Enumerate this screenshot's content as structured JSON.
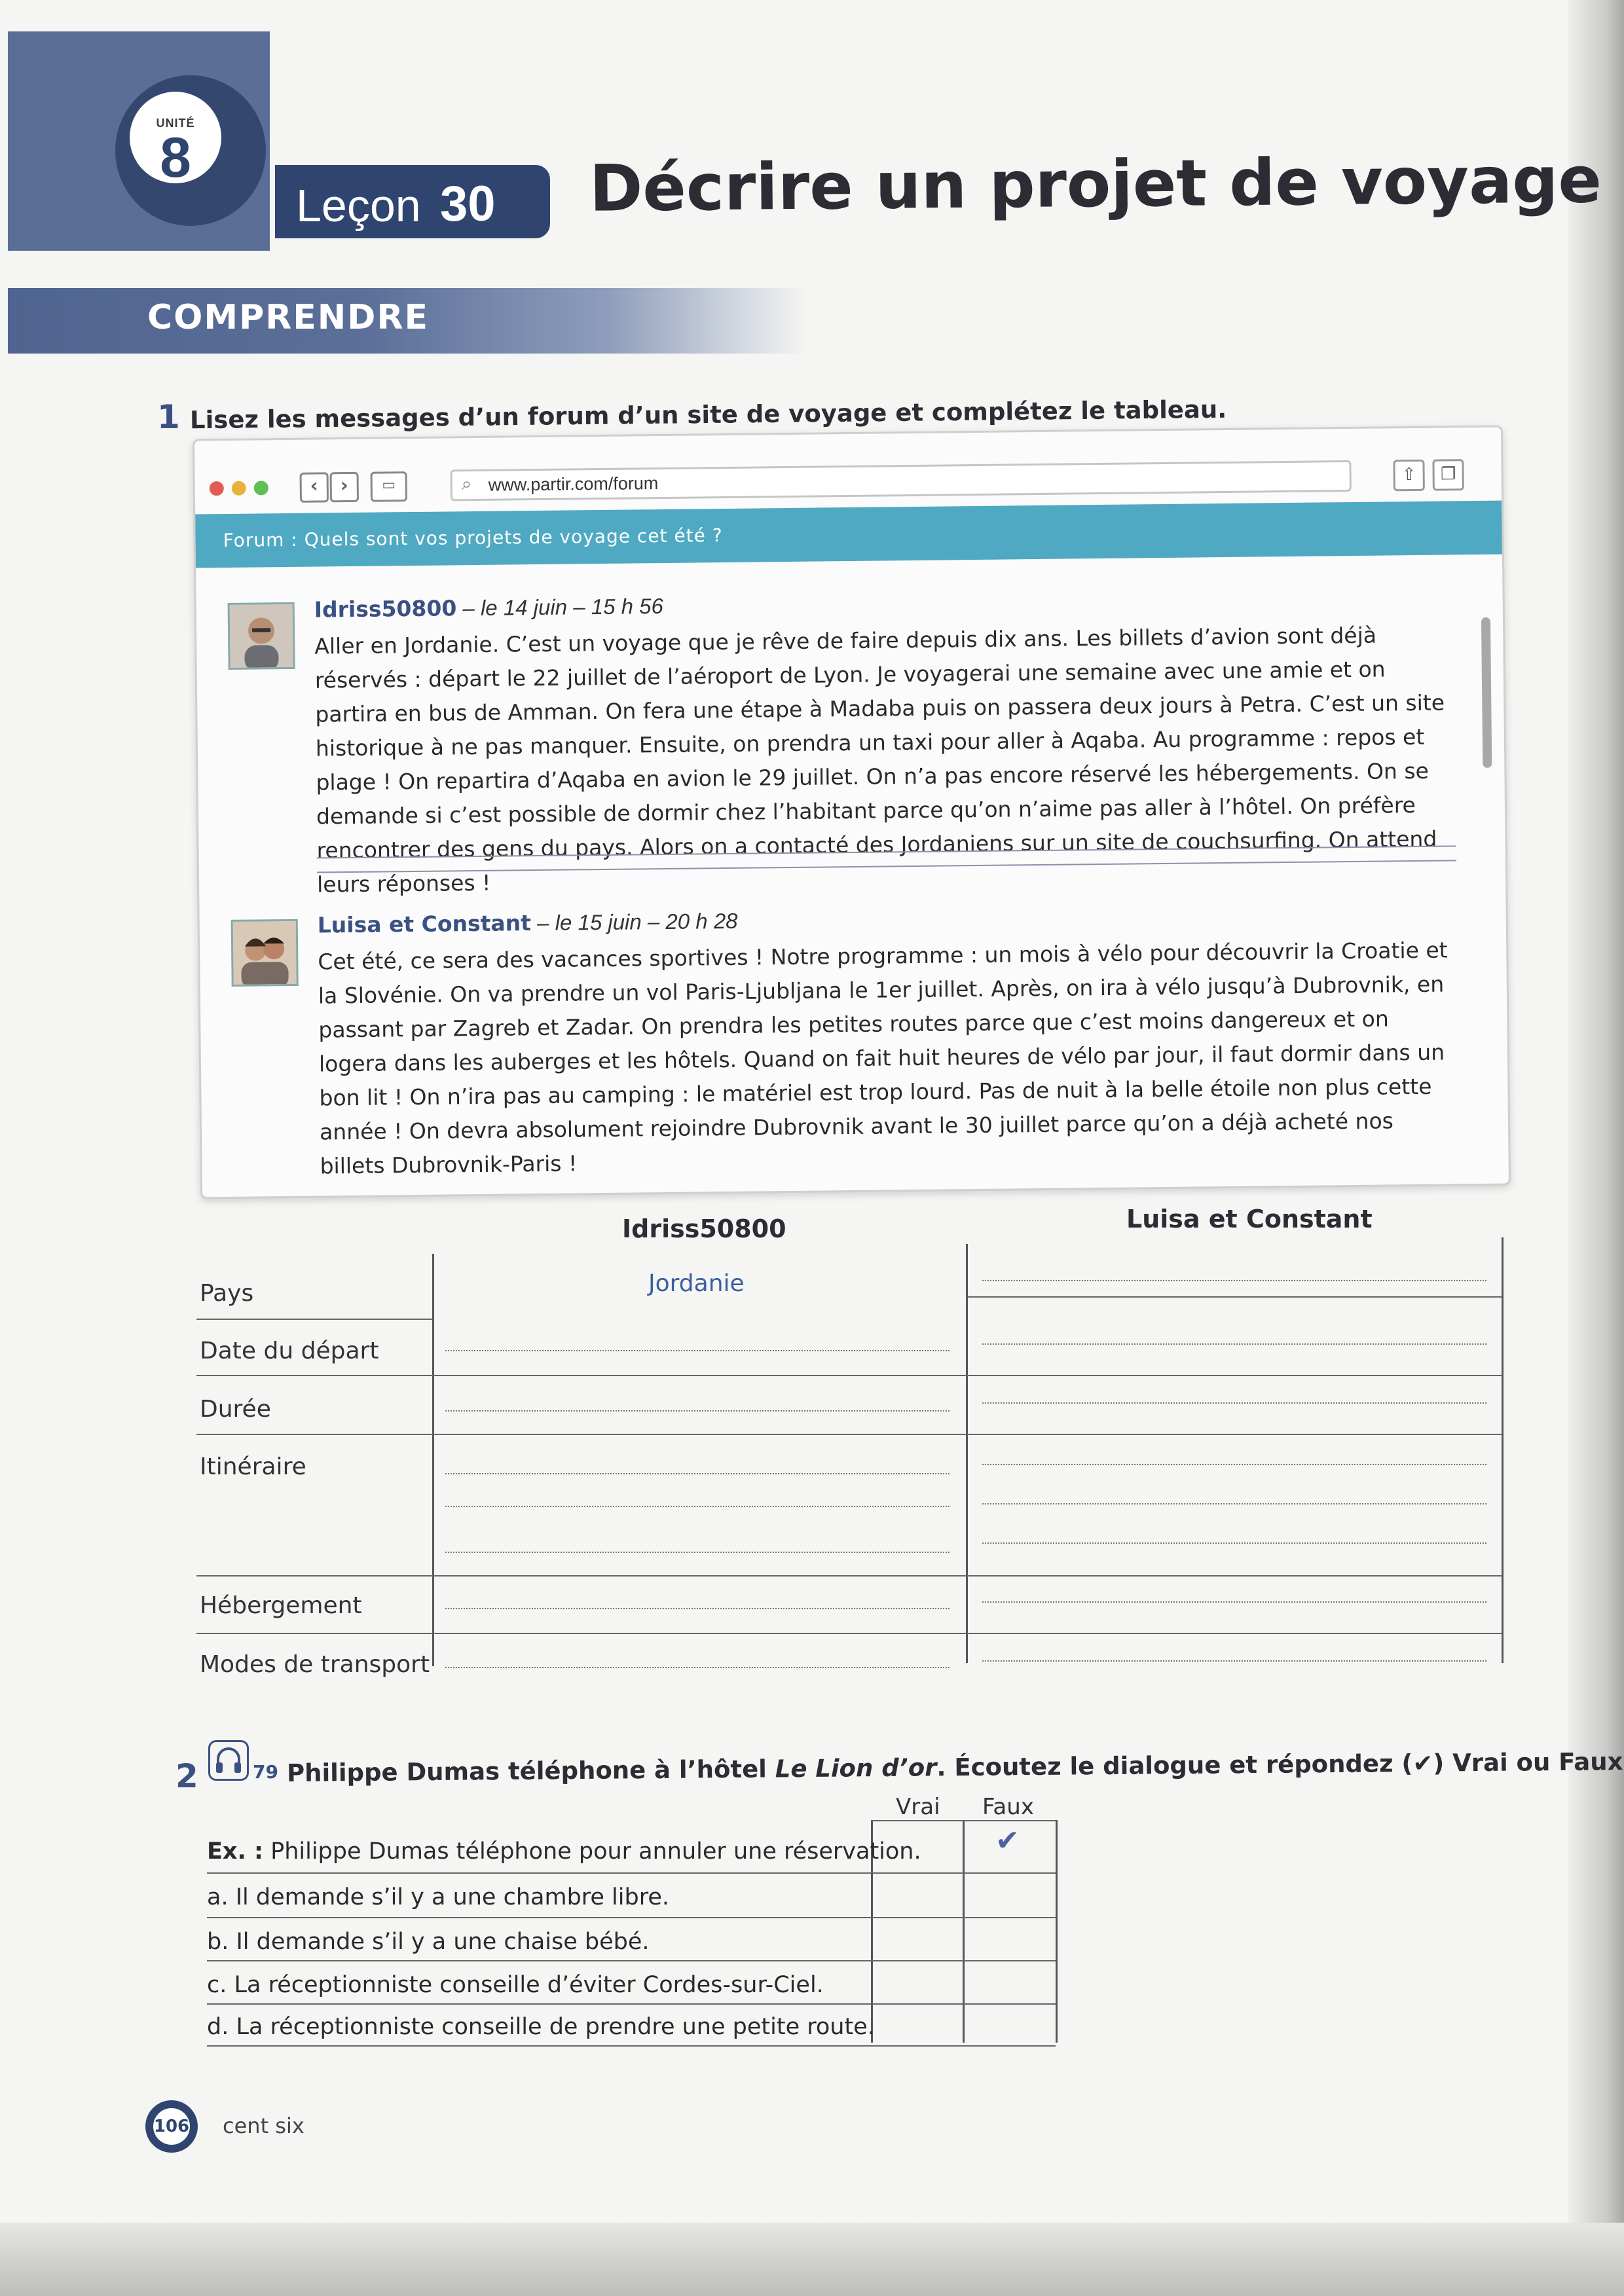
{
  "header": {
    "unit_label": "UNITÉ",
    "unit_number": "8",
    "lesson_word": "Leçon",
    "lesson_number": "30",
    "title": "Décrire un projet de voyage"
  },
  "section": {
    "title": "COMPRENDRE"
  },
  "exercise1": {
    "number": "1",
    "instruction": "Lisez les messages d’un forum d’un site de voyage et complétez le tableau.",
    "browser": {
      "url": "www.partir.com/forum",
      "forum_title": "Forum : Quels sont vos projets de voyage cet été ?"
    },
    "posts": [
      {
        "author": "Idriss50800",
        "date": " – le 14 juin – 15 h 56",
        "body": "Aller en Jordanie. C’est un voyage que je rêve de faire depuis dix ans. Les billets d’avion sont déjà réservés : départ le 22 juillet de l’aéroport de Lyon. Je voyagerai une semaine avec une amie et on partira en bus de Amman. On fera une étape à Madaba puis on passera deux jours à Petra. C’est un site historique à ne pas manquer. Ensuite, on prendra un taxi pour aller à Aqaba. Au programme : repos et plage ! On repartira d’Aqaba en avion le 29 juillet. On n’a pas encore réservé les hébergements. On se demande si c’est possible de dormir chez l’habitant parce qu’on n’aime pas aller à l’hôtel. On préfère rencontrer des gens du pays. Alors on a contacté des Jordaniens sur un site de couchsurfing. On attend leurs réponses !"
      },
      {
        "author": "Luisa et Constant",
        "date": " – le 15 juin – 20 h 28",
        "body": "Cet été, ce sera des vacances sportives ! Notre programme : un mois à vélo pour découvrir la Croatie et la Slovénie. On va prendre un vol Paris-Ljubljana le 1er juillet. Après, on ira à vélo jusqu’à Dubrovnik, en passant par Zagreb et Zadar. On prendra les petites routes parce que c’est moins dangereux et on logera dans les auberges et les hôtels. Quand on fait huit heures de vélo par jour, il faut dormir dans un bon lit ! On n’ira pas au camping : le matériel est trop lourd. Pas de nuit à la belle étoile non plus cette année ! On devra absolument rejoindre Dubrovnik avant le 30 juillet parce qu’on a déjà acheté nos billets Dubrovnik-Paris !"
      }
    ],
    "table": {
      "columns": [
        "Idriss50800",
        "Luisa et Constant"
      ],
      "rows": [
        "Pays",
        "Date du départ",
        "Durée",
        "Itinéraire",
        "Hébergement",
        "Modes de transport"
      ],
      "example_answer": "Jordanie"
    }
  },
  "exercise2": {
    "number": "2",
    "track": "79",
    "instruction_a": "Philippe Dumas téléphone à l’hôtel ",
    "instruction_italic": "Le Lion d’or",
    "instruction_b": ". Écoutez le dialogue et répondez (✔) Vrai ou Faux.",
    "vrai": "Vrai",
    "faux": "Faux",
    "statements": [
      {
        "prefix": "Ex. :",
        "text": " Philippe Dumas téléphone pour annuler une réservation."
      },
      {
        "prefix": "a.",
        "text": " Il demande s’il y a une chambre libre."
      },
      {
        "prefix": "b.",
        "text": " Il demande s’il y a une chaise bébé."
      },
      {
        "prefix": "c.",
        "text": " La réceptionniste conseille d’éviter Cordes-sur-Ciel."
      },
      {
        "prefix": "d.",
        "text": " La réceptionniste conseille de prendre une petite route."
      }
    ],
    "example_check": "✔"
  },
  "footer": {
    "page_number": "106",
    "page_words": "cent six"
  },
  "colors": {
    "accent": "#2f4570",
    "forum_bar": "#4fa9c2",
    "answer": "#3a5fa0"
  }
}
